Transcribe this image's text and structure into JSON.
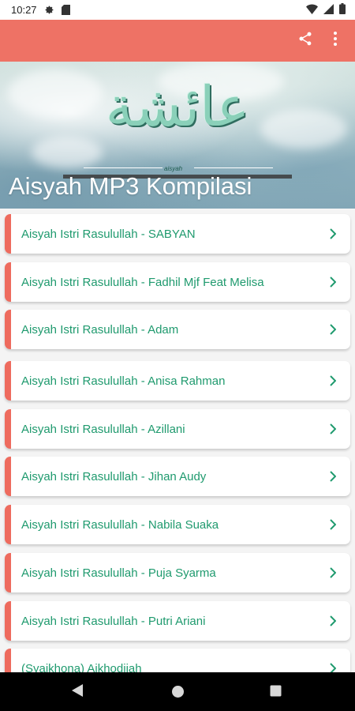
{
  "status_bar": {
    "time": "10:27",
    "icons": [
      "gear-icon",
      "sd-card-icon",
      "wifi-icon",
      "signal-icon",
      "battery-icon"
    ]
  },
  "app_bar": {
    "color": "#ee7265",
    "actions": [
      "share-icon",
      "overflow-menu-icon"
    ]
  },
  "banner": {
    "arabic_text": "عائشة",
    "subtitle": "aisyah",
    "title": "Aisyah MP3 Kompilasi"
  },
  "list": {
    "accent_color": "#ee6b5e",
    "text_color": "#1f9a6e",
    "items": [
      {
        "label": "Aisyah Istri Rasulullah - SABYAN"
      },
      {
        "label": "Aisyah Istri Rasulullah - Fadhil Mjf Feat Melisa"
      },
      {
        "label": "Aisyah Istri Rasulullah - Adam"
      },
      {
        "label": "Aisyah Istri Rasulullah - Anisa Rahman"
      },
      {
        "label": "Aisyah Istri Rasulullah - Azillani"
      },
      {
        "label": "Aisyah Istri Rasulullah - Jihan Audy"
      },
      {
        "label": "Aisyah Istri Rasulullah - Nabila Suaka"
      },
      {
        "label": "Aisyah Istri Rasulullah - Puja Syarma"
      },
      {
        "label": "Aisyah Istri Rasulullah - Putri Ariani"
      },
      {
        "label": "(Syaikhona) Aikhodijah"
      }
    ]
  },
  "nav_bar": {
    "buttons": [
      "back-icon",
      "home-icon",
      "recents-icon"
    ]
  }
}
